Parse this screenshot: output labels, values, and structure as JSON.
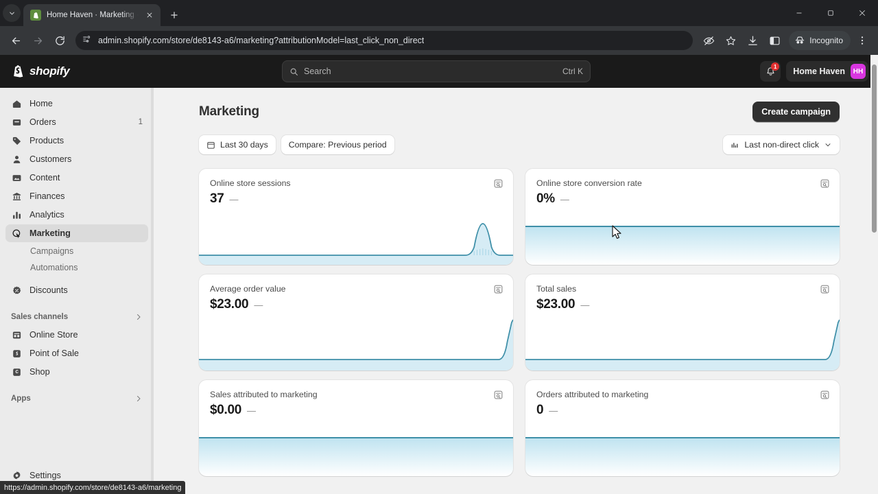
{
  "browser": {
    "tab": {
      "title": "Home Haven · Marketing · Shopify",
      "favicon": "shopify-favicon"
    },
    "newtab_label": "+",
    "url": "admin.shopify.com/store/de8143-a6/marketing?attributionModel=last_click_non_direct",
    "profile_label": "Incognito",
    "status_url": "https://admin.shopify.com/store/de8143-a6/marketing",
    "window": {
      "minimize": "—",
      "maximize": "□",
      "close": "✕"
    }
  },
  "topbar": {
    "logo_text": "shopify",
    "search": {
      "placeholder": "Search",
      "shortcut": "Ctrl K"
    },
    "notification_count": "1",
    "store_name": "Home Haven",
    "avatar_initials": "HH"
  },
  "sidebar": {
    "items": [
      {
        "label": "Home",
        "icon": "home-icon",
        "count": ""
      },
      {
        "label": "Orders",
        "icon": "orders-icon",
        "count": "1"
      },
      {
        "label": "Products",
        "icon": "products-tag-icon",
        "count": ""
      },
      {
        "label": "Customers",
        "icon": "customers-person-icon",
        "count": ""
      },
      {
        "label": "Content",
        "icon": "content-image-icon",
        "count": ""
      },
      {
        "label": "Finances",
        "icon": "finances-bank-icon",
        "count": ""
      },
      {
        "label": "Analytics",
        "icon": "analytics-bars-icon",
        "count": ""
      },
      {
        "label": "Marketing",
        "icon": "marketing-target-icon",
        "count": ""
      }
    ],
    "marketing_sub": [
      {
        "label": "Campaigns"
      },
      {
        "label": "Automations"
      }
    ],
    "discounts": {
      "label": "Discounts",
      "icon": "discount-icon"
    },
    "sales_channels": {
      "heading": "Sales channels",
      "items": [
        {
          "label": "Online Store",
          "icon": "online-store-icon"
        },
        {
          "label": "Point of Sale",
          "icon": "point-of-sale-icon"
        },
        {
          "label": "Shop",
          "icon": "shop-icon"
        }
      ]
    },
    "apps": {
      "heading": "Apps"
    },
    "settings": {
      "label": "Settings",
      "icon": "gear-icon"
    }
  },
  "main": {
    "title": "Marketing",
    "create_campaign": "Create campaign",
    "date_filter": "Last 30 days",
    "compare_filter": "Compare: Previous period",
    "attribution": "Last non-direct click"
  },
  "chart_data": [
    {
      "type": "area",
      "title": "Online store sessions",
      "value": "37",
      "delta": "—",
      "x": [
        0,
        1,
        2,
        3,
        4,
        5,
        6,
        7,
        8,
        9,
        10,
        11,
        12,
        13,
        14,
        15,
        16,
        17,
        18,
        19,
        20,
        21,
        22,
        23,
        24,
        25,
        26,
        27,
        28,
        29
      ],
      "values": [
        0,
        0,
        0,
        0,
        0,
        0,
        0,
        0,
        0,
        0,
        0,
        0,
        0,
        0,
        0,
        0,
        0,
        0,
        0,
        0,
        0,
        0,
        0,
        0,
        0,
        0,
        37,
        0,
        0,
        0
      ],
      "ylim": [
        0,
        37
      ],
      "grid": false,
      "legend": "none",
      "line_color": "#3e8fa8",
      "fill_color": "#cfe9f2"
    },
    {
      "type": "area",
      "title": "Online store conversion rate",
      "value": "0%",
      "delta": "—",
      "x": [
        0,
        1,
        2,
        3,
        4,
        5,
        6,
        7,
        8,
        9,
        10,
        11,
        12,
        13,
        14,
        15,
        16,
        17,
        18,
        19,
        20,
        21,
        22,
        23,
        24,
        25,
        26,
        27,
        28,
        29
      ],
      "values": [
        0,
        0,
        0,
        0,
        0,
        0,
        0,
        0,
        0,
        0,
        0,
        0,
        0,
        0,
        0,
        0,
        0,
        0,
        0,
        0,
        0,
        0,
        0,
        0,
        0,
        0,
        0,
        0,
        0,
        0
      ],
      "ylim": [
        0,
        1
      ],
      "grid": false,
      "legend": "none",
      "line_color": "#3e8fa8",
      "fill_color": "#cfe9f2"
    },
    {
      "type": "area",
      "title": "Average order value",
      "value": "$23.00",
      "delta": "—",
      "x": [
        0,
        1,
        2,
        3,
        4,
        5,
        6,
        7,
        8,
        9,
        10,
        11,
        12,
        13,
        14,
        15,
        16,
        17,
        18,
        19,
        20,
        21,
        22,
        23,
        24,
        25,
        26,
        27,
        28,
        29
      ],
      "values": [
        0,
        0,
        0,
        0,
        0,
        0,
        0,
        0,
        0,
        0,
        0,
        0,
        0,
        0,
        0,
        0,
        0,
        0,
        0,
        0,
        0,
        0,
        0,
        0,
        0,
        0,
        0,
        0,
        0,
        23
      ],
      "ylim": [
        0,
        23
      ],
      "grid": false,
      "legend": "none",
      "line_color": "#3e8fa8",
      "fill_color": "#cfe9f2"
    },
    {
      "type": "area",
      "title": "Total sales",
      "value": "$23.00",
      "delta": "—",
      "x": [
        0,
        1,
        2,
        3,
        4,
        5,
        6,
        7,
        8,
        9,
        10,
        11,
        12,
        13,
        14,
        15,
        16,
        17,
        18,
        19,
        20,
        21,
        22,
        23,
        24,
        25,
        26,
        27,
        28,
        29
      ],
      "values": [
        0,
        0,
        0,
        0,
        0,
        0,
        0,
        0,
        0,
        0,
        0,
        0,
        0,
        0,
        0,
        0,
        0,
        0,
        0,
        0,
        0,
        0,
        0,
        0,
        0,
        0,
        0,
        0,
        0,
        23
      ],
      "ylim": [
        0,
        23
      ],
      "grid": false,
      "legend": "none",
      "line_color": "#3e8fa8",
      "fill_color": "#cfe9f2"
    },
    {
      "type": "area",
      "title": "Sales attributed to marketing",
      "value": "$0.00",
      "delta": "—",
      "x": [
        0,
        1,
        2,
        3,
        4,
        5,
        6,
        7,
        8,
        9,
        10,
        11,
        12,
        13,
        14,
        15,
        16,
        17,
        18,
        19,
        20,
        21,
        22,
        23,
        24,
        25,
        26,
        27,
        28,
        29
      ],
      "values": [
        0,
        0,
        0,
        0,
        0,
        0,
        0,
        0,
        0,
        0,
        0,
        0,
        0,
        0,
        0,
        0,
        0,
        0,
        0,
        0,
        0,
        0,
        0,
        0,
        0,
        0,
        0,
        0,
        0,
        0
      ],
      "ylim": [
        0,
        1
      ],
      "grid": false,
      "legend": "none",
      "line_color": "#3e8fa8",
      "fill_color": "#cfe9f2"
    },
    {
      "type": "area",
      "title": "Orders attributed to marketing",
      "value": "0",
      "delta": "—",
      "x": [
        0,
        1,
        2,
        3,
        4,
        5,
        6,
        7,
        8,
        9,
        10,
        11,
        12,
        13,
        14,
        15,
        16,
        17,
        18,
        19,
        20,
        21,
        22,
        23,
        24,
        25,
        26,
        27,
        28,
        29
      ],
      "values": [
        0,
        0,
        0,
        0,
        0,
        0,
        0,
        0,
        0,
        0,
        0,
        0,
        0,
        0,
        0,
        0,
        0,
        0,
        0,
        0,
        0,
        0,
        0,
        0,
        0,
        0,
        0,
        0,
        0,
        0
      ],
      "ylim": [
        0,
        1
      ],
      "grid": false,
      "legend": "none",
      "line_color": "#3e8fa8",
      "fill_color": "#cfe9f2"
    }
  ],
  "colors": {
    "brand_dark": "#1a1a1a",
    "accent_avatar": "#d936e0",
    "spark_line": "#3e8fa8",
    "spark_fill": "#cfe9f2",
    "badge_red": "#e03030"
  }
}
